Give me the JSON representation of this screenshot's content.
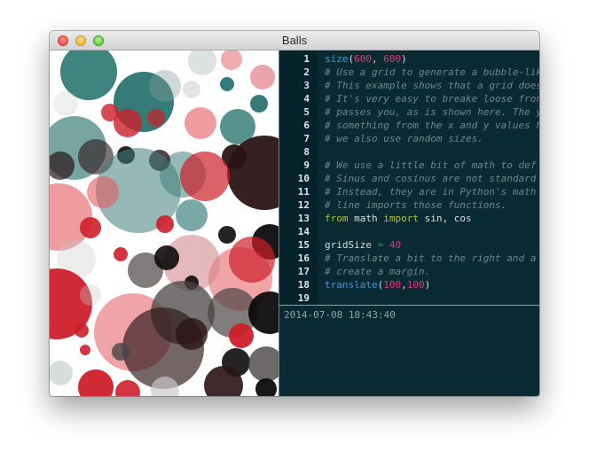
{
  "window": {
    "title": "Balls"
  },
  "editor": {
    "lines": [
      {
        "number": "1",
        "tokens": [
          {
            "t": "size",
            "k": "fn"
          },
          {
            "t": "(",
            "k": "id"
          },
          {
            "t": "600",
            "k": "num"
          },
          {
            "t": ", ",
            "k": "id"
          },
          {
            "t": "600",
            "k": "num"
          },
          {
            "t": ")",
            "k": "id"
          }
        ]
      },
      {
        "number": "2",
        "tokens": [
          {
            "t": "# Use a grid to generate a bubble-lik",
            "k": "cm"
          }
        ]
      },
      {
        "number": "3",
        "tokens": [
          {
            "t": "# This example shows that a grid does",
            "k": "cm"
          }
        ]
      },
      {
        "number": "4",
        "tokens": [
          {
            "t": "# It's very easy to breake loose fron",
            "k": "cm"
          }
        ]
      },
      {
        "number": "5",
        "tokens": [
          {
            "t": "# passes you, as is shown here. The y",
            "k": "cm"
          }
        ]
      },
      {
        "number": "6",
        "tokens": [
          {
            "t": "# something from the x and y values h",
            "k": "cm"
          }
        ]
      },
      {
        "number": "7",
        "tokens": [
          {
            "t": "# we also use random sizes.",
            "k": "cm"
          }
        ]
      },
      {
        "number": "8",
        "tokens": []
      },
      {
        "number": "9",
        "tokens": [
          {
            "t": "# We use a little bit of math to def",
            "k": "cm"
          }
        ]
      },
      {
        "number": "10",
        "tokens": [
          {
            "t": "# Sinus and cosinus are not standard",
            "k": "cm"
          }
        ]
      },
      {
        "number": "11",
        "tokens": [
          {
            "t": "# Instead, they are in Python's math",
            "k": "cm"
          }
        ]
      },
      {
        "number": "12",
        "tokens": [
          {
            "t": "# line imports those functions.",
            "k": "cm"
          }
        ]
      },
      {
        "number": "13",
        "tokens": [
          {
            "t": "from",
            "k": "kw"
          },
          {
            "t": " math ",
            "k": "id"
          },
          {
            "t": "import",
            "k": "kw"
          },
          {
            "t": " sin, cos",
            "k": "id"
          }
        ]
      },
      {
        "number": "14",
        "tokens": []
      },
      {
        "number": "15",
        "tokens": [
          {
            "t": "gridSize ",
            "k": "id"
          },
          {
            "t": "=",
            "k": "op"
          },
          {
            "t": " ",
            "k": "id"
          },
          {
            "t": "40",
            "k": "num"
          }
        ]
      },
      {
        "number": "16",
        "tokens": [
          {
            "t": "# Translate a bit to the right and a",
            "k": "cm"
          }
        ]
      },
      {
        "number": "17",
        "tokens": [
          {
            "t": "# create a margin.",
            "k": "cm"
          }
        ]
      },
      {
        "number": "18",
        "tokens": [
          {
            "t": "translate",
            "k": "fn"
          },
          {
            "t": "(",
            "k": "id"
          },
          {
            "t": "100",
            "k": "num"
          },
          {
            "t": ",",
            "k": "id"
          },
          {
            "t": "100",
            "k": "num"
          },
          {
            "t": ")",
            "k": "id"
          }
        ]
      },
      {
        "number": "19",
        "tokens": []
      }
    ]
  },
  "console": {
    "output": "2014-07-08 18:43:40"
  },
  "colors": {
    "editor_bg": "#0a2a33",
    "gutter_bg": "#06222a",
    "function": "#3d9be0",
    "number": "#e0337a",
    "comment": "#6e878c",
    "keyword": "#b7c233",
    "console_text": "#8fa4a8",
    "ball_palette": [
      "#1f6e6a",
      "#3f7f7b",
      "#8a9d9c",
      "#cc1f2a",
      "#e45a60",
      "#d48a8e",
      "#2a1416",
      "#4a4444",
      "#0c0c0c",
      "#c9c9c9"
    ]
  },
  "icons": {
    "close": "close-button-icon",
    "minimize": "minimize-button-icon",
    "zoom": "zoom-button-icon"
  }
}
